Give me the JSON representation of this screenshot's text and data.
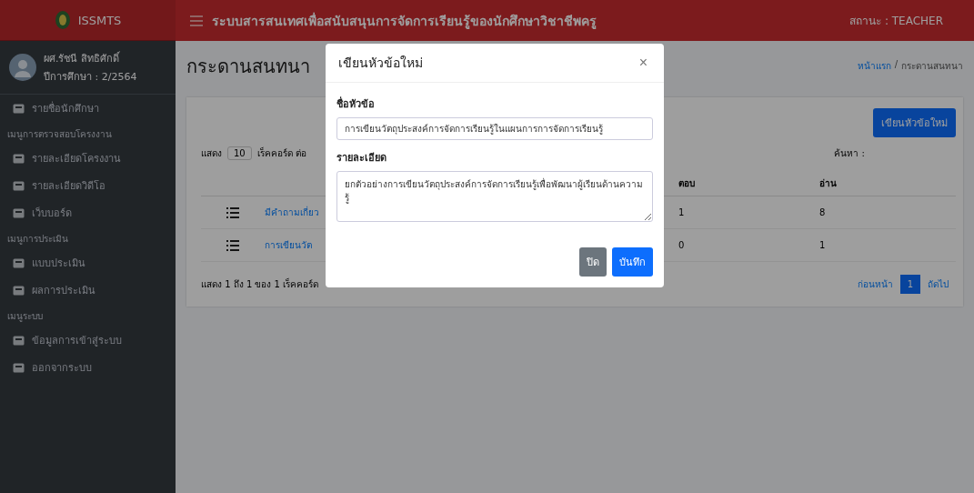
{
  "brand": {
    "name": "ISSMTS"
  },
  "header": {
    "title": "ระบบสารสนเทศเพื่อสนับสนุนการจัดการเรียนรู้ของนักศึกษาวิชาชีพครู",
    "status": "สถานะ : TEACHER"
  },
  "user": {
    "name": "ผศ.รัชนี สิทธิศักดิ์",
    "year": "ปีการศึกษา : 2/2564"
  },
  "sidebar": {
    "items": [
      {
        "kind": "link",
        "label": "รายชื่อนักศึกษา"
      },
      {
        "kind": "section",
        "label": "เมนูการตรวจสอบโครงงาน"
      },
      {
        "kind": "link",
        "label": "รายละเอียดโครงงาน"
      },
      {
        "kind": "link",
        "label": "รายละเอียดวิดีโอ"
      },
      {
        "kind": "link",
        "label": "เว็บบอร์ด"
      },
      {
        "kind": "section",
        "label": "เมนูการประเมิน"
      },
      {
        "kind": "link",
        "label": "แบบประเมิน"
      },
      {
        "kind": "link",
        "label": "ผลการประเมิน"
      },
      {
        "kind": "section",
        "label": "เมนูระบบ"
      },
      {
        "kind": "link",
        "label": "ข้อมูลการเข้าสู่ระบบ"
      },
      {
        "kind": "link",
        "label": "ออกจากระบบ"
      }
    ]
  },
  "page": {
    "title": "กระดานสนทนา",
    "breadcrumb": [
      "หน้าแรก",
      "กระดานสนทนา"
    ],
    "breadcrumb_separator": "/",
    "new_button": "เขียนหัวข้อใหม่"
  },
  "table": {
    "length_label": "แสดง",
    "length_value": "10",
    "length_suffix": "เร็คคอร์ด ต่อ",
    "search_label": "ค้นหา :",
    "columns": [
      "ตอบ",
      "อ่าน"
    ],
    "rows": [
      {
        "topic": "มีคำถามเกี่ยว",
        "replies": "1",
        "reads": "8"
      },
      {
        "topic": "การเขียนวัต",
        "replies": "0",
        "reads": "1"
      }
    ],
    "info": "แสดง 1 ถึง 1 ของ 1 เร็คคอร์ด",
    "pagination": [
      {
        "label": "ก่อนหน้า",
        "selected": false
      },
      {
        "label": "1",
        "selected": true
      },
      {
        "label": "ถัดไป",
        "selected": false
      }
    ]
  },
  "modal": {
    "title": "เขียนหัวข้อใหม่",
    "close": "×",
    "fields": [
      {
        "kind": "input",
        "label": "ชื่อหัวข้อ",
        "value": "การเขียนวัตถุประสงค์การจัดการเรียนรู้ในแผนการการจัดการเรียนรู้"
      },
      {
        "kind": "textarea",
        "label": "รายละเอียด",
        "value": "ยกตัวอย่างการเขียนวัตถุประสงค์การจัดการเรียนรู้เพื่อพัฒนาผู้เรียนด้านความรู้"
      }
    ],
    "buttons": [
      {
        "kind": "secondary",
        "label": "ปิด"
      },
      {
        "kind": "primary",
        "label": "บันทึก"
      }
    ]
  }
}
